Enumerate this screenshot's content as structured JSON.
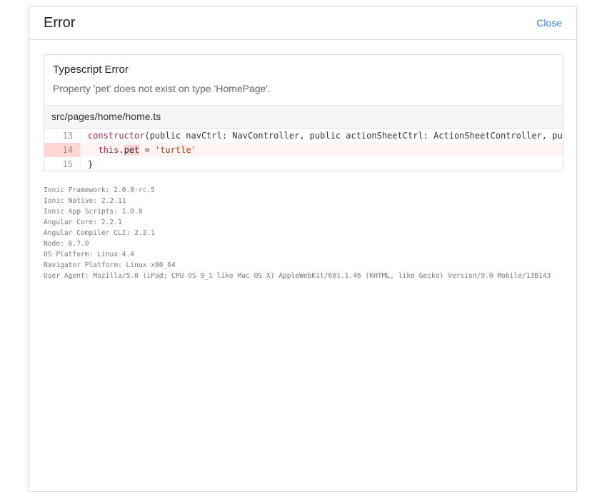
{
  "modal": {
    "title": "Error",
    "close_label": "Close"
  },
  "error": {
    "type": "Typescript Error",
    "message": "Property 'pet' does not exist on type 'HomePage'.",
    "file": "src/pages/home/home.ts"
  },
  "code_lines": [
    {
      "number": "13",
      "text": "constructor(public navCtrl: NavController, public actionSheetCtrl: ActionSheetController, pub"
    },
    {
      "number": "14",
      "text": "  this.pet = 'turtle'"
    },
    {
      "number": "15",
      "text": "}"
    }
  ],
  "system_info": [
    "Ionic Framework: 2.0.0-rc.5",
    "Ionic Native: 2.2.11",
    "Ionic App Scripts: 1.0.0",
    "Angular Core: 2.2.1",
    "Angular Compiler CLI: 2.2.1",
    "Node: 6.7.0",
    "OS Platform: Linux 4.4",
    "Navigator Platform: Linux x86_64",
    "User Agent: Mozilla/5.0 (iPad; CPU OS 9_1 like Mac OS X) AppleWebKit/601.1.46 (KHTML, like Gecko) Version/9.0 Mobile/13B143"
  ],
  "colors": {
    "accent": "#3a7fe0",
    "highlight_line": "#fff3f3",
    "highlight_gutter": "#ffd6d6"
  }
}
